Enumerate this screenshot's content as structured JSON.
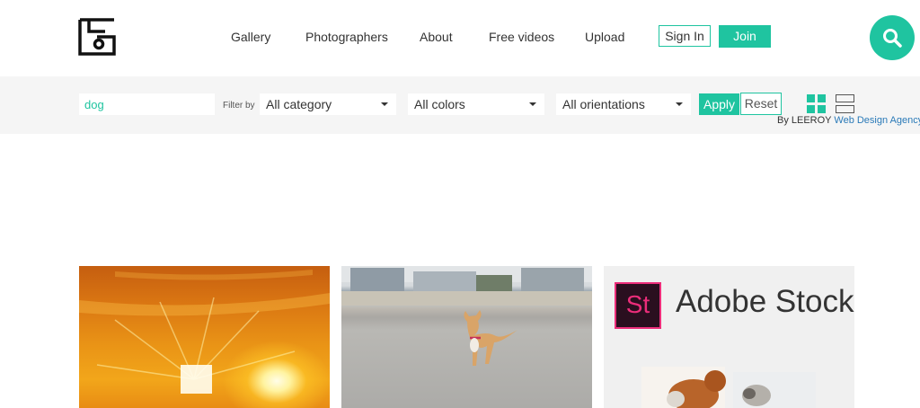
{
  "header": {
    "nav": [
      {
        "label": "Gallery"
      },
      {
        "label": "Photographers"
      },
      {
        "label": "About"
      },
      {
        "label": "Free videos"
      },
      {
        "label": "Upload"
      }
    ],
    "signin_label": "Sign In",
    "join_label": "Join"
  },
  "filter": {
    "search_value": "dog",
    "filter_by_label": "Filter by",
    "category": "All category",
    "colors": "All colors",
    "orientations": "All orientations",
    "apply_label": "Apply",
    "reset_label": "Reset",
    "credit_prefix": "By LEEROY",
    "credit_link": "Web Design Agency"
  },
  "gallery": {
    "stock_badge": "St",
    "stock_title": "Adobe Stock"
  },
  "colors": {
    "accent": "#1fc4a0",
    "link": "#2a7ab8"
  }
}
